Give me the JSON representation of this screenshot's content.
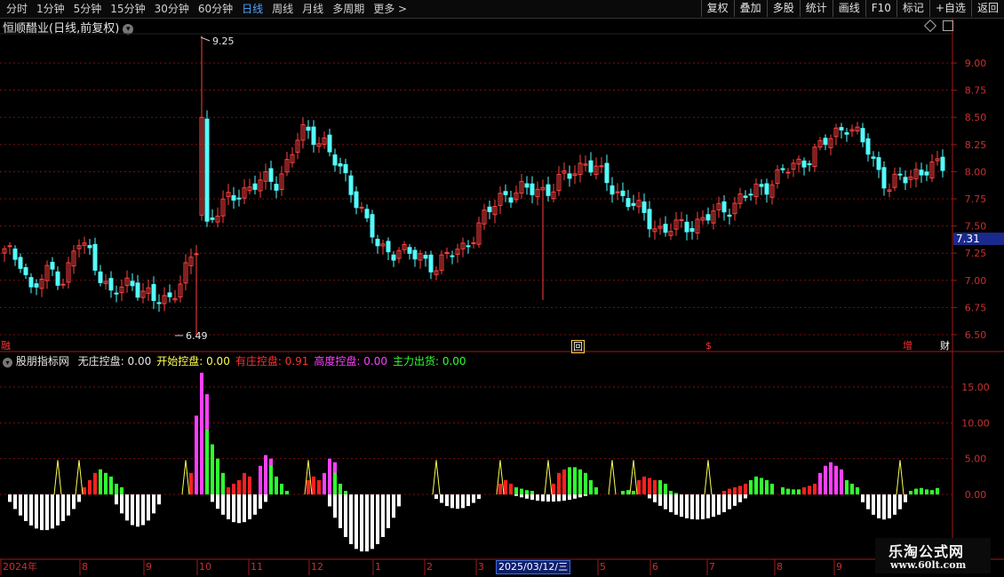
{
  "toolbar": {
    "periods": [
      "分时",
      "1分钟",
      "5分钟",
      "15分钟",
      "30分钟",
      "60分钟",
      "日线",
      "周线",
      "月线",
      "多周期",
      "更多 >"
    ],
    "active_period": "日线",
    "right_tools": [
      "复权",
      "叠加",
      "多股",
      "统计",
      "画线",
      "F10",
      "标记",
      "+自选",
      "返回"
    ]
  },
  "main_chart": {
    "title": "恒顺醋业(日线,前复权)",
    "y_ticks": [
      "9.00",
      "8.75",
      "8.50",
      "8.25",
      "8.00",
      "7.75",
      "7.50",
      "7.25",
      "7.00",
      "6.75",
      "6.50"
    ],
    "high_label": "9.25",
    "low_label": "6.49",
    "current_price": "7.31",
    "event_tags": [
      {
        "text": "融",
        "color": "#ff3030"
      },
      {
        "text": "回",
        "color": "#ffd24d"
      },
      {
        "text": "$",
        "color": "#ff3030"
      },
      {
        "text": "增",
        "color": "#ff3030"
      },
      {
        "text": "财",
        "color": "#ffffff"
      }
    ],
    "colors": {
      "up": "#ff4040",
      "down": "#54fcfc",
      "grid": "#7a1010",
      "axis": "#a01818"
    }
  },
  "indicator": {
    "name": "股朋指标网",
    "lines": [
      {
        "label": "无庄控盘:",
        "value": "0.00",
        "color": "#e6e6e6"
      },
      {
        "label": "开始控盘:",
        "value": "0.00",
        "color": "#ffff50"
      },
      {
        "label": "有庄控盘:",
        "value": "0.91",
        "color": "#ff3232"
      },
      {
        "label": "高度控盘:",
        "value": "0.00",
        "color": "#ff40ff"
      },
      {
        "label": "主力出货:",
        "value": "0.00",
        "color": "#30ff30"
      }
    ],
    "y_ticks": [
      "15.00",
      "10.00",
      "5.00",
      "0.00"
    ]
  },
  "date_axis": {
    "labels": [
      "2024年",
      "8",
      "9",
      "10",
      "11",
      "12",
      "1",
      "2",
      "3",
      "5",
      "6",
      "7",
      "8",
      "9"
    ],
    "cursor_date": "2025/03/12/三"
  },
  "watermark": {
    "line1": "乐淘公式网",
    "line2": "www.60lt.com"
  }
}
